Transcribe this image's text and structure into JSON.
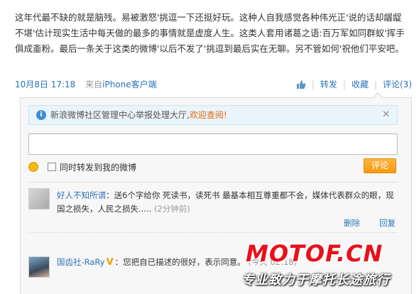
{
  "post": {
    "text": "这年代最不缺的就是脑残。易被激怒'挑逗一下还挺好玩。这种人自我感觉各种伟光正'说的话却龌龊不堪'估计现实生活中每天做的最多的事情就是虚度人生。这类人套用诸葛之语:百万军如同群蚁'挥手俱成齑粉。最后一条关于这类的微博'以后不发了'挑逗到最后实在无聊。另不管如何'祝他们平安吧。",
    "time": "10月8日 17:18",
    "source_prefix": "来自",
    "source_link": "iPhone客户端"
  },
  "actions": {
    "like_icon": "thumbs-up-icon",
    "repost": "转发",
    "favorite": "收藏",
    "comment": "评论(3)"
  },
  "notice": {
    "icon": "info-icon",
    "text": "新浪微博社区管理中心举报处理大厅,",
    "link": "欢迎查阅!",
    "close": "✕"
  },
  "comment_box": {
    "emoji_icon": "smiley-icon",
    "also_repost_label": "同时转发到我的微博",
    "submit": "评论"
  },
  "comments": [
    {
      "user": "好人不知所谓",
      "text": "：送6个字给你 死读书，读死书 最基本相互尊重都不会，媒体代表群众的眼，现国之损失，人民之损失.....",
      "time": "(2分钟前)",
      "delete": "删除",
      "reply": "回复"
    },
    {
      "user": "国齿社-RaRy",
      "verified_icon": "verified-v-icon",
      "text": "：您把自已描述的很好，表示同意。",
      "time": "(今天 02:18)"
    }
  ],
  "watermark": {
    "logo": "MOTOF.CN",
    "slogan": "专业致力于摩托长途旅行"
  }
}
